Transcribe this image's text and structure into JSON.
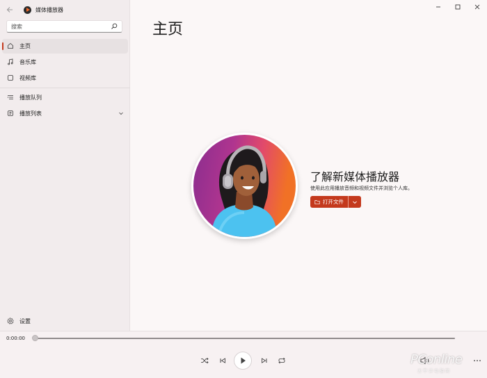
{
  "window": {
    "app_title": "媒体播放器",
    "controls": [
      "minimize-icon",
      "maximize-icon",
      "close-icon"
    ]
  },
  "sidebar": {
    "search_placeholder": "搜索",
    "items": [
      {
        "label": "主页",
        "icon": "home-icon",
        "active": true
      },
      {
        "label": "音乐库",
        "icon": "music-note-icon",
        "active": false
      },
      {
        "label": "视频库",
        "icon": "video-library-icon",
        "active": false
      },
      {
        "label": "播放队列",
        "icon": "queue-icon",
        "active": false
      },
      {
        "label": "播放列表",
        "icon": "playlist-icon",
        "active": false
      }
    ],
    "settings_label": "设置"
  },
  "main": {
    "page_title": "主页",
    "hero": {
      "heading": "了解新媒体播放器",
      "subtitle": "使用此应用播放音频和视频文件并浏览个人库。",
      "open_button_label": "打开文件"
    }
  },
  "player": {
    "time": "0:00:00",
    "progress": 0
  },
  "watermark": {
    "text": "PConline",
    "sub": "太平洋电脑网"
  },
  "colors": {
    "accent": "#c4391d",
    "sidebar_bg": "#f2eced",
    "main_bg": "#fbf7f7"
  }
}
